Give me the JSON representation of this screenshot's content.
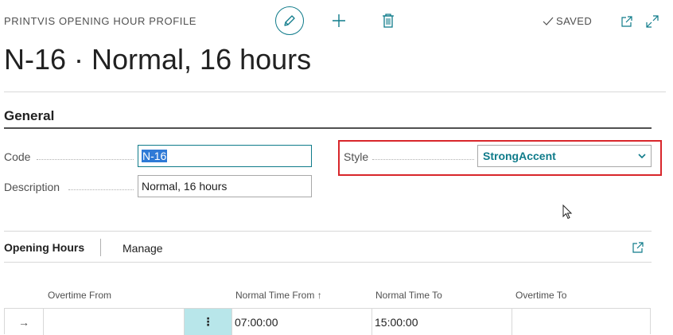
{
  "header": {
    "caption": "PRINTVIS OPENING HOUR PROFILE",
    "saved_label": "SAVED",
    "title": "N-16 · Normal, 16 hours"
  },
  "toolbar": {
    "edit_icon": "pencil-icon",
    "add_icon": "plus-icon",
    "delete_icon": "trash-icon",
    "open_new_window_icon": "open-in-new-window-icon",
    "collapse_icon": "expand-arrows-icon"
  },
  "general": {
    "section_title": "General",
    "code": {
      "label": "Code",
      "value": "N-16"
    },
    "description": {
      "label": "Description",
      "value": "Normal, 16 hours"
    },
    "style": {
      "label": "Style",
      "value": "StrongAccent"
    }
  },
  "opening_hours": {
    "tabs": [
      {
        "label": "Opening Hours"
      },
      {
        "label": "Manage"
      }
    ],
    "columns": {
      "overtime_from": "Overtime From",
      "normal_time_from": "Normal Time From",
      "normal_time_from_sort": "↑",
      "normal_time_to": "Normal Time To",
      "overtime_to": "Overtime To"
    },
    "rows": [
      {
        "indicator": "→",
        "overtime_from": "",
        "menu": "⋮",
        "normal_time_from": "07:00:00",
        "normal_time_to": "15:00:00",
        "overtime_to": ""
      }
    ]
  },
  "colors": {
    "accent": "#0f7b8a",
    "highlight_border": "#d8262b",
    "selection": "#2f7ad6"
  }
}
